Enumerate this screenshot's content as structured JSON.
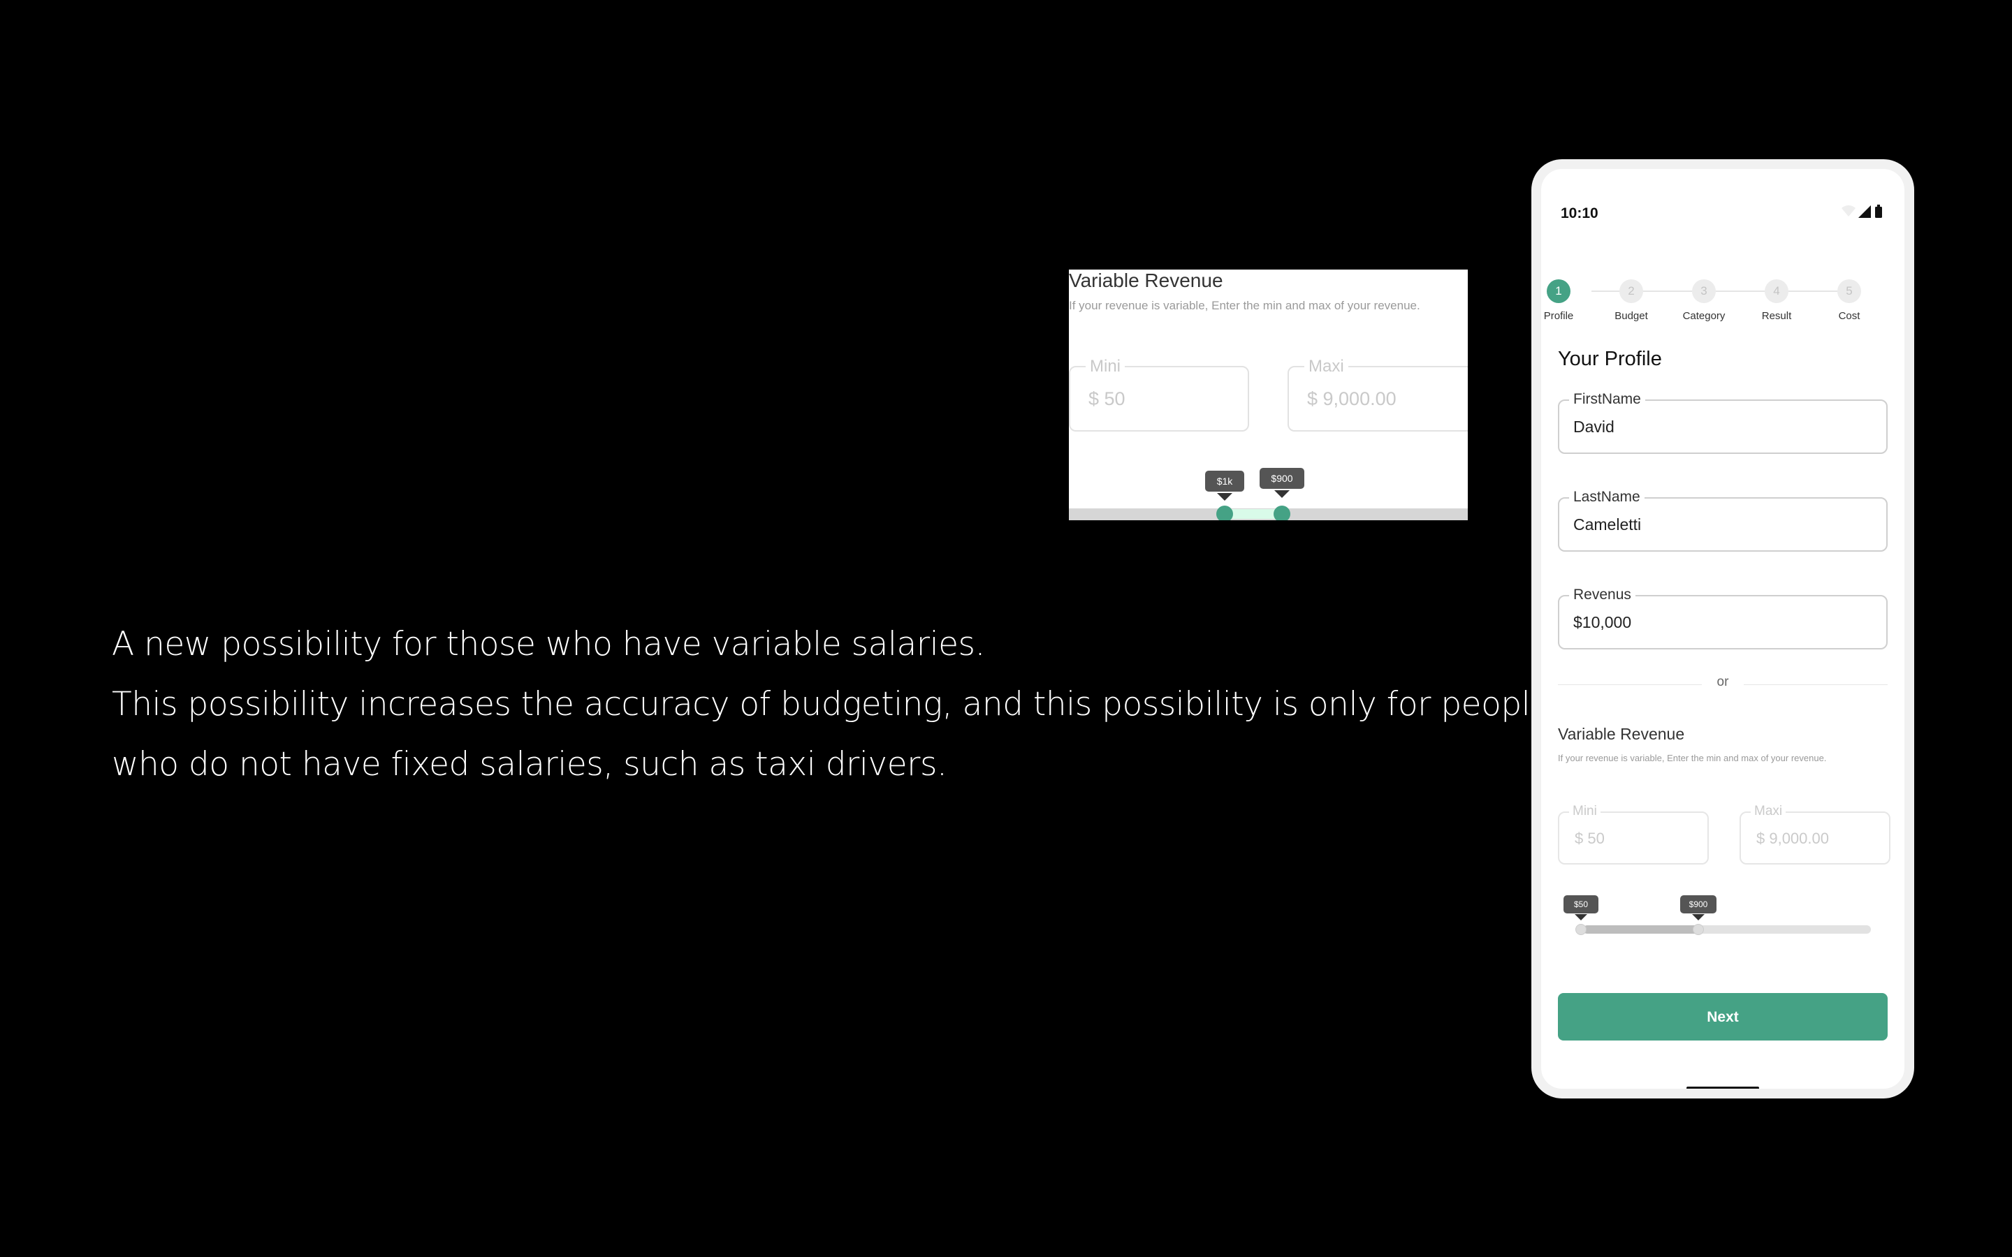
{
  "caption": {
    "line1": "A new possibility for those who have variable salaries.",
    "line2": "This possibility increases the accuracy of budgeting, and this possibility is only for people",
    "line3": "who do not have fixed salaries, such as taxi drivers."
  },
  "zoom_card": {
    "title": "Variable Revenue",
    "description": "If your revenue is variable, Enter the min and max of your revenue.",
    "min_label": "Mini",
    "min_value": "$ 50",
    "max_label": "Maxi",
    "max_value": "$ 9,000.00",
    "tip_left": "$1k",
    "tip_right": "$900",
    "accent": "#45a285",
    "range_color": "#d9fbe9"
  },
  "phone": {
    "status": {
      "time": "10:10",
      "icons": [
        "wifi-icon",
        "signal-icon",
        "battery-icon"
      ]
    },
    "steps": [
      {
        "num": "1",
        "label": "Profile",
        "active": true
      },
      {
        "num": "2",
        "label": "Budget",
        "active": false
      },
      {
        "num": "3",
        "label": "Category",
        "active": false
      },
      {
        "num": "4",
        "label": "Result",
        "active": false
      },
      {
        "num": "5",
        "label": "Cost",
        "active": false
      }
    ],
    "heading": "Your Profile",
    "form": {
      "first_name": {
        "label": "FirstName",
        "value": "David"
      },
      "last_name": {
        "label": "LastName",
        "value": "Cameletti"
      },
      "revenue": {
        "label": "Revenus",
        "value": "$10,000"
      }
    },
    "divider_text": "or",
    "variable_revenue": {
      "title": "Variable Revenue",
      "description": "If your revenue is variable, Enter the min and max of your revenue.",
      "min_label": "Mini",
      "min_value": "$ 50",
      "max_label": "Maxi",
      "max_value": "$ 9,000.00",
      "tip_left": "$50",
      "tip_right": "$900"
    },
    "next_label": "Next",
    "accent": "#45a285"
  }
}
